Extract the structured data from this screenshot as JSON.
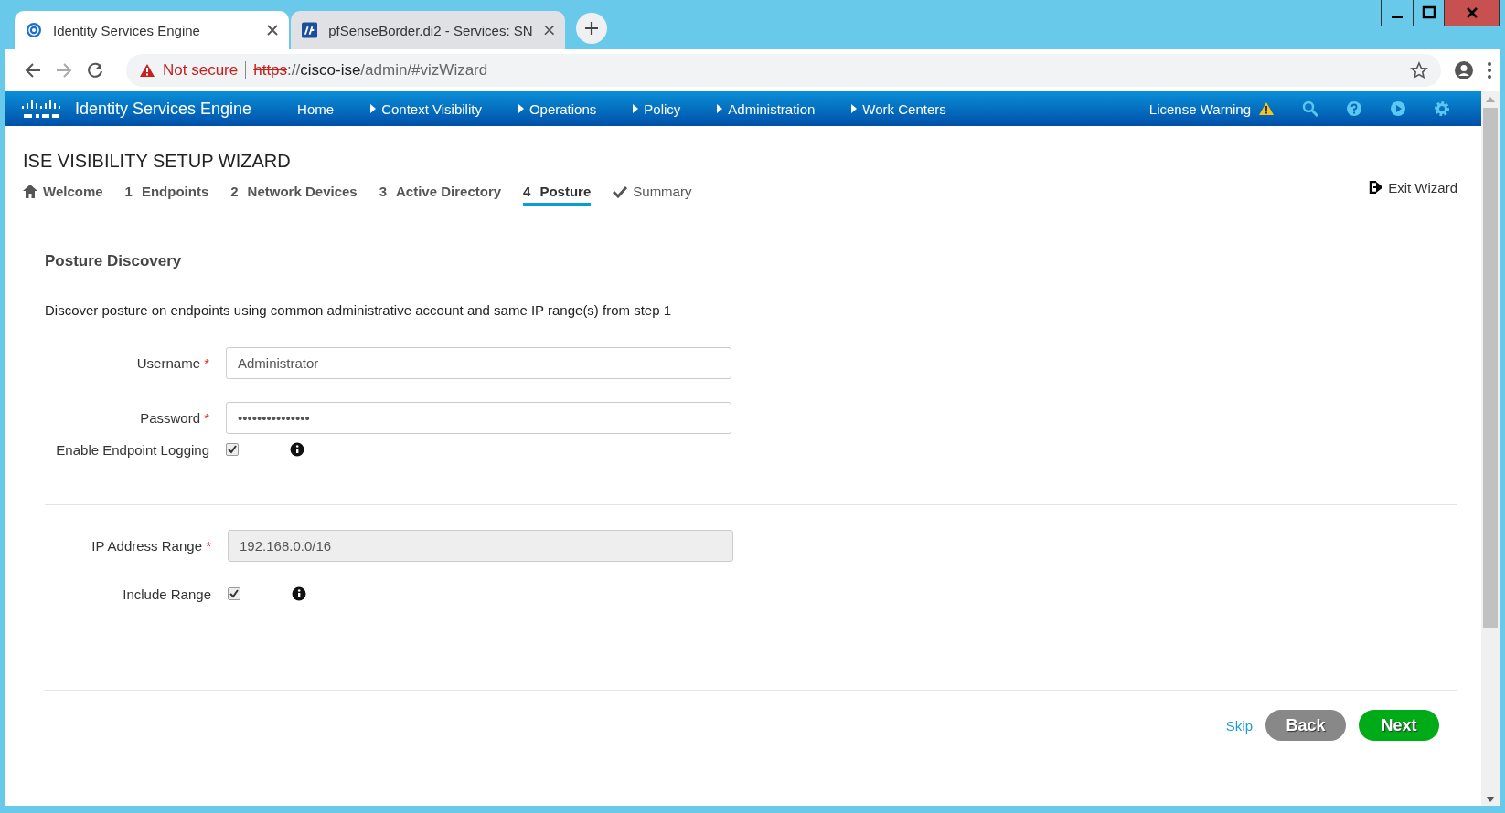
{
  "browser": {
    "tabs": [
      {
        "title": "Identity Services Engine",
        "selected": true,
        "kind": "ise"
      },
      {
        "title": "pfSenseBorder.di2 - Services: SN",
        "selected": false,
        "kind": "pf"
      }
    ],
    "address": {
      "security": "Not secure",
      "scheme": "https",
      "separator": "://",
      "host": "cisco-ise",
      "path": "/admin/#vizWizard"
    }
  },
  "header": {
    "product": "Identity Services Engine",
    "nav": [
      {
        "label": "Home",
        "has_menu": false
      },
      {
        "label": "Context Visibility",
        "has_menu": true
      },
      {
        "label": "Operations",
        "has_menu": true
      },
      {
        "label": "Policy",
        "has_menu": true
      },
      {
        "label": "Administration",
        "has_menu": true
      },
      {
        "label": "Work Centers",
        "has_menu": true
      }
    ],
    "license_warning": "License Warning"
  },
  "wizard": {
    "title": "ISE VISIBILITY SETUP WIZARD",
    "exit": "Exit Wizard",
    "steps": [
      {
        "kind": "home",
        "label": "Welcome",
        "selected": false
      },
      {
        "kind": "number",
        "number": "1",
        "label": "Endpoints",
        "selected": false
      },
      {
        "kind": "number",
        "number": "2",
        "label": "Network Devices",
        "selected": false
      },
      {
        "kind": "number",
        "number": "3",
        "label": "Active Directory",
        "selected": false
      },
      {
        "kind": "number",
        "number": "4",
        "label": "Posture",
        "selected": true
      },
      {
        "kind": "check",
        "label": "Summary",
        "selected": false
      }
    ]
  },
  "section": {
    "title": "Posture Discovery",
    "description": "Discover posture on endpoints using common administrative account and same IP range(s) from step 1",
    "groups": [
      [
        {
          "kind": "text",
          "label": "Username",
          "required_mark": "*",
          "value": "Administrator"
        },
        {
          "kind": "text",
          "label": "Password",
          "required_mark": "*",
          "value": "•••••••••••••••"
        },
        {
          "kind": "checkbox",
          "label": "Enable Endpoint Logging",
          "checked": true,
          "info": true
        }
      ],
      [
        {
          "kind": "text",
          "label": "IP Address Range",
          "required_mark": "*",
          "value": "192.168.0.0/16",
          "disabled": true
        },
        {
          "kind": "checkbox",
          "label": "Include Range",
          "checked": true,
          "info": true
        }
      ]
    ]
  },
  "buttons": {
    "skip": "Skip",
    "back": "Back",
    "next": "Next"
  }
}
